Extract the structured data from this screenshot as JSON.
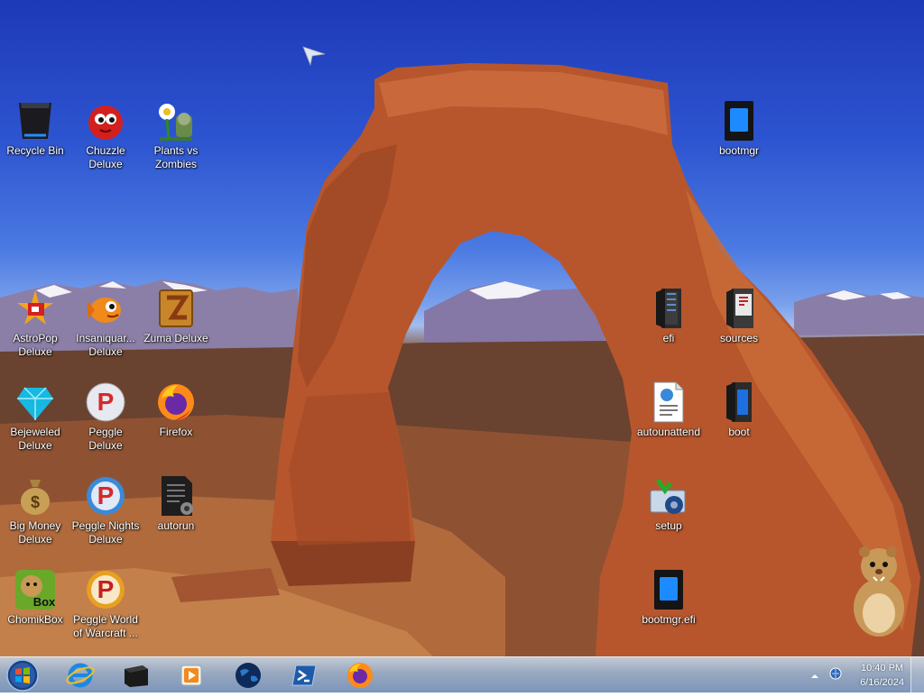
{
  "desktop": {
    "icons": [
      {
        "label": "Recycle Bin",
        "icon": "recycle-bin-icon"
      },
      {
        "label": "Chuzzle Deluxe",
        "icon": "chuzzle-icon"
      },
      {
        "label": "Plants vs Zombies",
        "icon": "plants-vs-zombies-icon"
      },
      {
        "label": "AstroPop Deluxe",
        "icon": "astropop-icon"
      },
      {
        "label": "Insaniquar... Deluxe",
        "icon": "insaniquarium-icon"
      },
      {
        "label": "Zuma Deluxe",
        "icon": "zuma-icon"
      },
      {
        "label": "Bejeweled Deluxe",
        "icon": "bejeweled-icon"
      },
      {
        "label": "Peggle Deluxe",
        "icon": "peggle-icon"
      },
      {
        "label": "Firefox",
        "icon": "firefox-icon"
      },
      {
        "label": "Big Money Deluxe",
        "icon": "money-bag-icon"
      },
      {
        "label": "Peggle Nights Deluxe",
        "icon": "peggle-nights-icon"
      },
      {
        "label": "autorun",
        "icon": "autorun-file-icon"
      },
      {
        "label": "ChomikBox",
        "icon": "chomikbox-icon"
      },
      {
        "label": "Peggle World of Warcraft ...",
        "icon": "peggle-wow-icon"
      },
      {
        "label": "bootmgr",
        "icon": "bootmgr-file-icon"
      },
      {
        "label": "efi",
        "icon": "folder-icon"
      },
      {
        "label": "sources",
        "icon": "folder-icon"
      },
      {
        "label": "autounattend",
        "icon": "xml-file-icon"
      },
      {
        "label": "boot",
        "icon": "folder-icon"
      },
      {
        "label": "setup",
        "icon": "setup-icon"
      },
      {
        "label": "bootmgr.efi",
        "icon": "bootmgr-efi-file-icon"
      }
    ]
  },
  "taskbar": {
    "pinned": [
      {
        "name": "internet-explorer",
        "icon": "internet-explorer-icon"
      },
      {
        "name": "window-manager",
        "icon": "black-box-icon"
      },
      {
        "name": "media-player",
        "icon": "media-player-icon"
      },
      {
        "name": "globe-app",
        "icon": "globe-icon"
      },
      {
        "name": "powershell",
        "icon": "powershell-icon"
      },
      {
        "name": "firefox",
        "icon": "firefox-icon"
      }
    ],
    "clock": {
      "time": "10:40 PM",
      "date": "6/16/2024"
    }
  }
}
